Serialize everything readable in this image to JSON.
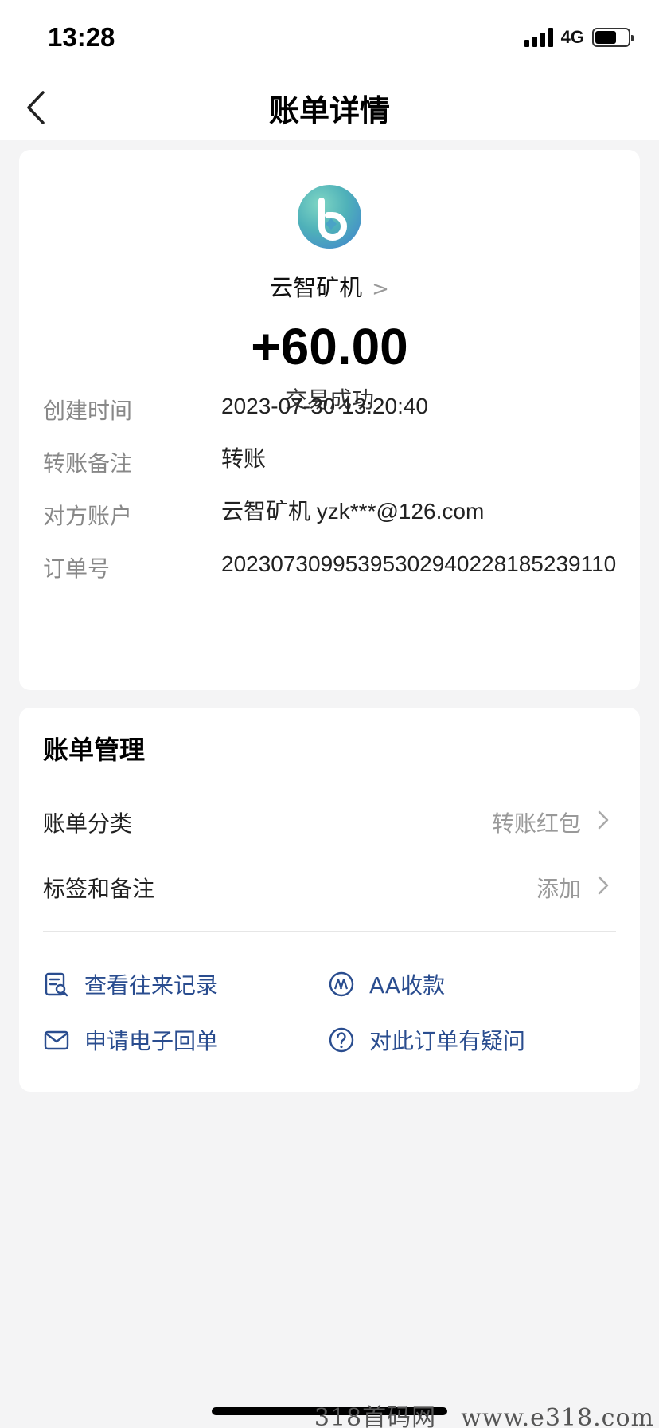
{
  "status_bar": {
    "time": "13:28",
    "network": "4G",
    "battery_level": 0.65
  },
  "nav": {
    "title": "账单详情",
    "back_icon": "chevron-left-icon"
  },
  "transaction": {
    "merchant_name": "云智矿机",
    "amount": "+60.00",
    "status": "交易成功",
    "details": [
      {
        "label": "创建时间",
        "value": "2023-07-30 13:20:40"
      },
      {
        "label": "转账备注",
        "value": "转账"
      },
      {
        "label": "对方账户",
        "value": "云智矿机 yzk***@126.com"
      },
      {
        "label": "订单号",
        "value": "20230730995395302940228185239110"
      }
    ]
  },
  "manage": {
    "title": "账单管理",
    "rows": [
      {
        "label": "账单分类",
        "value": "转账红包"
      },
      {
        "label": "标签和备注",
        "value": "添加"
      }
    ],
    "actions": [
      {
        "label": "查看往来记录",
        "icon": "records-search-icon"
      },
      {
        "label": "AA收款",
        "icon": "aa-collect-icon"
      },
      {
        "label": "申请电子回单",
        "icon": "envelope-icon"
      },
      {
        "label": "对此订单有疑问",
        "icon": "question-icon"
      }
    ]
  },
  "watermark": "318首码网　www.e318.com",
  "colors": {
    "accent_link": "#2a4d8f",
    "background": "#f4f4f5",
    "card": "#ffffff"
  }
}
